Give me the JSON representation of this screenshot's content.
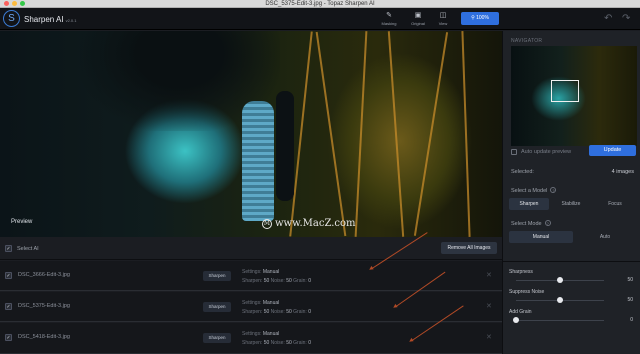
{
  "window": {
    "title": "DSC_5375-Edit-3.jpg - Topaz Sharpen AI",
    "lights": [
      "#fc615d",
      "#fdbc40",
      "#34c84a"
    ]
  },
  "toolbar": {
    "app_name": "Sharpen AI",
    "app_version": "v2.0.1",
    "tools": [
      {
        "label": "Masking",
        "icon": "brush-icon"
      },
      {
        "label": "Original",
        "icon": "image-icon"
      },
      {
        "label": "View",
        "icon": "view-icon"
      }
    ],
    "zoom_label": "100%",
    "accent": "#2f6fde"
  },
  "preview": {
    "label": "Preview",
    "watermark": "www.MacZ.com"
  },
  "sidebar": {
    "navigator_label": "NAVIGATOR",
    "auto_update_label": "Auto update preview",
    "update_button": "Update",
    "selected_label": "Selected:",
    "selected_count": "4 images",
    "model_label": "Select a Model",
    "models": [
      "Sharpen",
      "Stabilize",
      "Focus"
    ],
    "active_model": "Sharpen",
    "mode_label": "Select Mode",
    "modes": [
      "Manual",
      "Auto"
    ],
    "active_mode": "Manual",
    "sliders": [
      {
        "name": "Sharpness",
        "value": "50",
        "fraction": 0.5
      },
      {
        "name": "Suppress Noise",
        "value": "50",
        "fraction": 0.5
      },
      {
        "name": "Add Grain",
        "value": "0",
        "fraction": 0.0
      }
    ]
  },
  "list": {
    "select_all_label": "Select AI",
    "remove_all_label": "Remove All Images",
    "rows": [
      {
        "filename": "DSC_3666-Edit-3.jpg",
        "model": "Sharpen",
        "settings_label": "Settings:",
        "settings_value": "Manual",
        "sharpen_label": "Sharpen:",
        "sharpen_value": "50",
        "noise_label": "Noise:",
        "noise_value": "50",
        "grain_label": "Grain:",
        "grain_value": "0"
      },
      {
        "filename": "DSC_5375-Edit-3.jpg",
        "model": "Sharpen",
        "settings_label": "Settings:",
        "settings_value": "Manual",
        "sharpen_label": "Sharpen:",
        "sharpen_value": "50",
        "noise_label": "Noise:",
        "noise_value": "50",
        "grain_label": "Grain:",
        "grain_value": "0"
      },
      {
        "filename": "DSC_5418-Edit-3.jpg",
        "model": "Sharpen",
        "settings_label": "Settings:",
        "settings_value": "Manual",
        "sharpen_label": "Sharpen:",
        "sharpen_value": "50",
        "noise_label": "Noise:",
        "noise_value": "50",
        "grain_label": "Grain:",
        "grain_value": "0"
      }
    ]
  }
}
